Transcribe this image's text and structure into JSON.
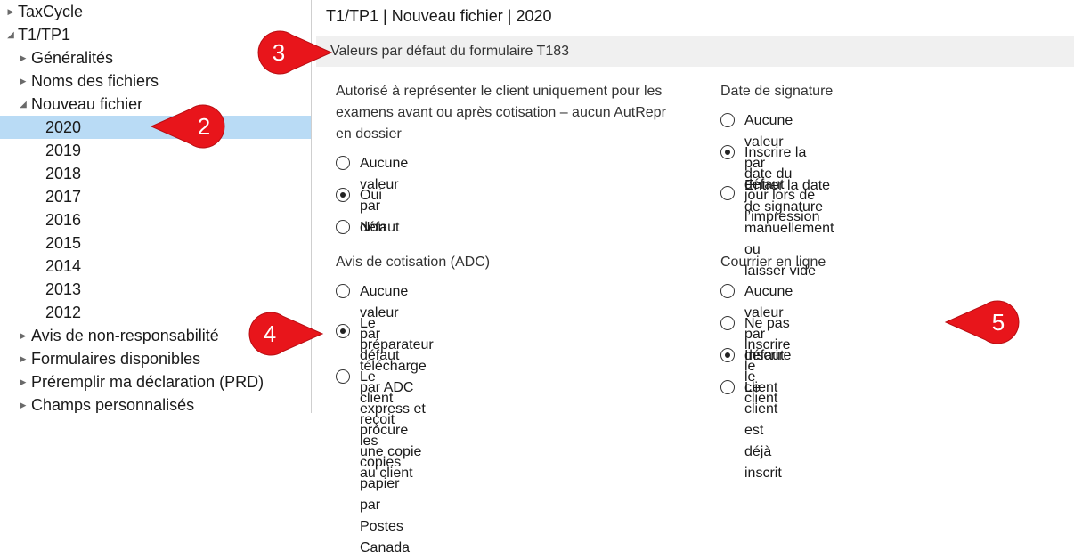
{
  "tree": {
    "items": [
      {
        "label": "TaxCycle",
        "level": 0,
        "state": "closed"
      },
      {
        "label": "T1/TP1",
        "level": 0,
        "state": "open"
      },
      {
        "label": "Généralités",
        "level": 1,
        "state": "closed"
      },
      {
        "label": "Noms des fichiers",
        "level": 1,
        "state": "closed"
      },
      {
        "label": "Nouveau fichier",
        "level": 1,
        "state": "open"
      },
      {
        "label": "2020",
        "level": 2,
        "selected": true
      },
      {
        "label": "2019",
        "level": 2
      },
      {
        "label": "2018",
        "level": 2
      },
      {
        "label": "2017",
        "level": 2
      },
      {
        "label": "2016",
        "level": 2
      },
      {
        "label": "2015",
        "level": 2
      },
      {
        "label": "2014",
        "level": 2
      },
      {
        "label": "2013",
        "level": 2
      },
      {
        "label": "2012",
        "level": 2
      },
      {
        "label": "Avis de non-responsabilité",
        "level": 1,
        "state": "closed"
      },
      {
        "label": "Formulaires disponibles",
        "level": 1,
        "state": "closed"
      },
      {
        "label": "Préremplir ma déclaration (PRD)",
        "level": 1,
        "state": "closed"
      },
      {
        "label": "Champs personnalisés",
        "level": 1,
        "state": "closed"
      }
    ]
  },
  "panel": {
    "title": "T1/TP1 | Nouveau fichier | 2020",
    "section_header": "Valeurs par défaut du formulaire T183",
    "groups": {
      "autorise": {
        "label_lines": [
          "Autorisé à représenter le client uniquement pour les",
          "examens avant ou après cotisation – aucun AutRepr",
          "en dossier"
        ],
        "options": [
          {
            "lines": [
              "Aucune valeur par défaut"
            ],
            "checked": false
          },
          {
            "lines": [
              "Oui"
            ],
            "checked": true
          },
          {
            "lines": [
              "Non"
            ],
            "checked": false
          }
        ]
      },
      "date_signature": {
        "label_lines": [
          "Date de signature"
        ],
        "options": [
          {
            "lines": [
              "Aucune valeur par défaut"
            ],
            "checked": false
          },
          {
            "lines": [
              "Inscrire la date du jour lors de l’impression"
            ],
            "checked": true
          },
          {
            "lines": [
              "Entrer la date de signature manuellement ou",
              "laisser vide"
            ],
            "checked": false
          }
        ]
      },
      "avis_cotisation": {
        "label_lines": [
          "Avis de cotisation (ADC)"
        ],
        "options": [
          {
            "lines": [
              "Aucune valeur par défaut"
            ],
            "checked": false
          },
          {
            "lines": [
              "Le préparateur télécharge par ADC express et",
              "procure une copie au client"
            ],
            "checked": true
          },
          {
            "lines": [
              "Le client reçoit les copies papier par Postes Canada"
            ],
            "checked": false
          }
        ]
      },
      "courrier": {
        "label_lines": [
          "Courrier en ligne"
        ],
        "options": [
          {
            "lines": [
              "Aucune valeur par défaut"
            ],
            "checked": false
          },
          {
            "lines": [
              "Ne pas inscrire le client"
            ],
            "checked": false
          },
          {
            "lines": [
              "Inscrire le client"
            ],
            "checked": true
          },
          {
            "lines": [
              "Le client est déjà inscrit"
            ],
            "checked": false
          }
        ]
      }
    }
  },
  "callouts": [
    "2",
    "3",
    "4",
    "5"
  ],
  "colors": {
    "selection": "#b9dbf5",
    "callout_red": "#e8151b",
    "section_bg": "#f0f0f0"
  }
}
